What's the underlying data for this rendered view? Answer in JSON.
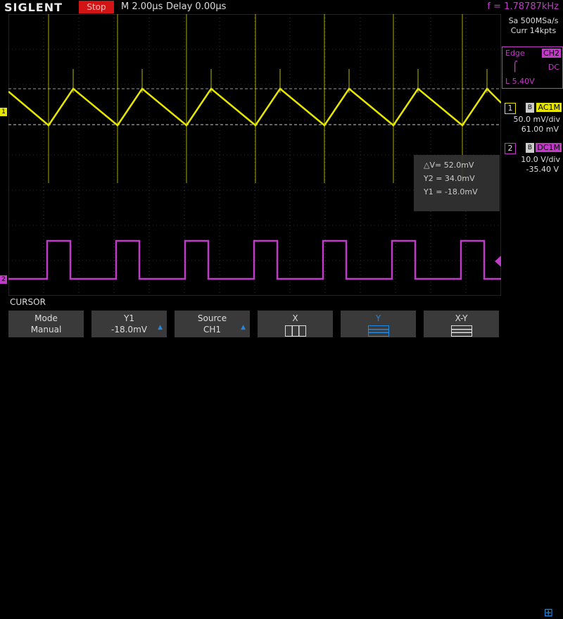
{
  "topbar": {
    "brand": "SIGLENT",
    "run_state": "Stop",
    "timebase": "M 2.00μs",
    "delay": "Delay 0.00μs",
    "frequency": "f = 1.78787kHz"
  },
  "acquisition": {
    "sample_rate": "Sa 500MSa/s",
    "memory": "Curr 14kpts"
  },
  "trigger": {
    "type": "Edge",
    "source": "CH2",
    "coupling": "DC",
    "level": "L  5.40V"
  },
  "channels": [
    {
      "number": "1",
      "bw": "B",
      "coupling": "AC1M",
      "scale": "50.0 mV/div",
      "offset": "61.00 mV",
      "color": "#e6e600"
    },
    {
      "number": "2",
      "bw": "B",
      "coupling": "DC1M",
      "scale": "10.0 V/div",
      "offset": "-35.40 V",
      "color": "#c23ac8"
    }
  ],
  "cursor": {
    "delta_v": "△V= 52.0mV",
    "y2": "Y2 = 34.0mV",
    "y1": "Y1 = -18.0mV"
  },
  "menu": {
    "title": "CURSOR",
    "softkeys": [
      {
        "line1": "Mode",
        "line2": "Manual"
      },
      {
        "line1": "Y1",
        "line2": "-18.0mV"
      },
      {
        "line1": "Source",
        "line2": "CH1"
      },
      {
        "line1": "X",
        "line2": ""
      },
      {
        "line1": "Y",
        "line2": ""
      },
      {
        "line1": "X-Y",
        "line2": ""
      }
    ]
  },
  "colors": {
    "ch1": "#e6e600",
    "ch2": "#c23ac8",
    "accent": "#1e88e5",
    "stop": "#d21414"
  },
  "markers": {
    "ch1": "1",
    "ch2": "2"
  }
}
